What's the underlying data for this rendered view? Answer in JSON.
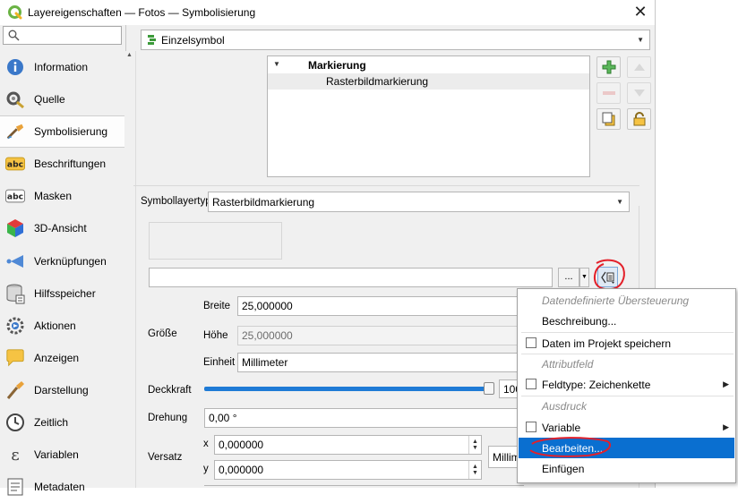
{
  "window": {
    "title": "Layereigenschaften — Fotos — Symbolisierung",
    "close_glyph": "✕"
  },
  "sidebar": {
    "search_placeholder": "",
    "items": [
      {
        "label": "Information",
        "icon": "info-icon"
      },
      {
        "label": "Quelle",
        "icon": "source-icon"
      },
      {
        "label": "Symbolisierung",
        "icon": "paintbrush-icon",
        "active": true
      },
      {
        "label": "Beschriftungen",
        "icon": "labels-abc-icon"
      },
      {
        "label": "Masken",
        "icon": "masks-abc-icon"
      },
      {
        "label": "3D-Ansicht",
        "icon": "3d-cube-icon"
      },
      {
        "label": "Verknüpfungen",
        "icon": "joins-icon"
      },
      {
        "label": "Hilfsspeicher",
        "icon": "auxiliary-storage-icon"
      },
      {
        "label": "Aktionen",
        "icon": "actions-gear-icon"
      },
      {
        "label": "Anzeigen",
        "icon": "display-tip-icon"
      },
      {
        "label": "Darstellung",
        "icon": "rendering-brush-icon"
      },
      {
        "label": "Zeitlich",
        "icon": "clock-icon"
      },
      {
        "label": "Variablen",
        "icon": "epsilon-icon"
      },
      {
        "label": "Metadaten",
        "icon": "metadata-icon"
      }
    ]
  },
  "renderer": {
    "value": "Einzelsymbol"
  },
  "symbol_tree": {
    "root": "Markierung",
    "child": "Rasterbildmarkierung"
  },
  "symbol_layer": {
    "label": "Symbollayertyp",
    "value": "Rasterbildmarkierung"
  },
  "file_path": {
    "value": "",
    "browse_label": "..."
  },
  "size": {
    "group_label": "Größe",
    "width_label": "Breite",
    "width_value": "25,000000",
    "height_label": "Höhe",
    "height_value": "25,000000",
    "unit_label": "Einheit",
    "unit_value": "Millimeter"
  },
  "opacity": {
    "label": "Deckkraft",
    "value_text": "100",
    "fraction": 1.0
  },
  "rotation": {
    "label": "Drehung",
    "value": "0,00 °"
  },
  "offset": {
    "group_label": "Versatz",
    "x_label": "x",
    "x_value": "0,000000",
    "y_label": "y",
    "y_value": "0,000000",
    "unit_value": "Millimeter"
  },
  "context_menu": {
    "items": [
      {
        "label": "Datendefinierte Übersteuerung",
        "kind": "header"
      },
      {
        "label": "Beschreibung...",
        "kind": "item"
      },
      {
        "label": "Daten im Projekt speichern",
        "kind": "checkbox"
      },
      {
        "label": "Attributfeld",
        "kind": "header"
      },
      {
        "label": "Feldtype: Zeichenkette",
        "kind": "submenu"
      },
      {
        "label": "Ausdruck",
        "kind": "header"
      },
      {
        "label": "Variable",
        "kind": "submenu"
      },
      {
        "label": "Bearbeiten...",
        "kind": "item",
        "highlighted": true
      },
      {
        "label": "Einfügen",
        "kind": "item"
      }
    ]
  },
  "colors": {
    "highlight": "#0a6fd0",
    "annotation_red": "#e3202a",
    "slider": "#1f7bd6",
    "qgis_green": "#3c9a3a"
  }
}
